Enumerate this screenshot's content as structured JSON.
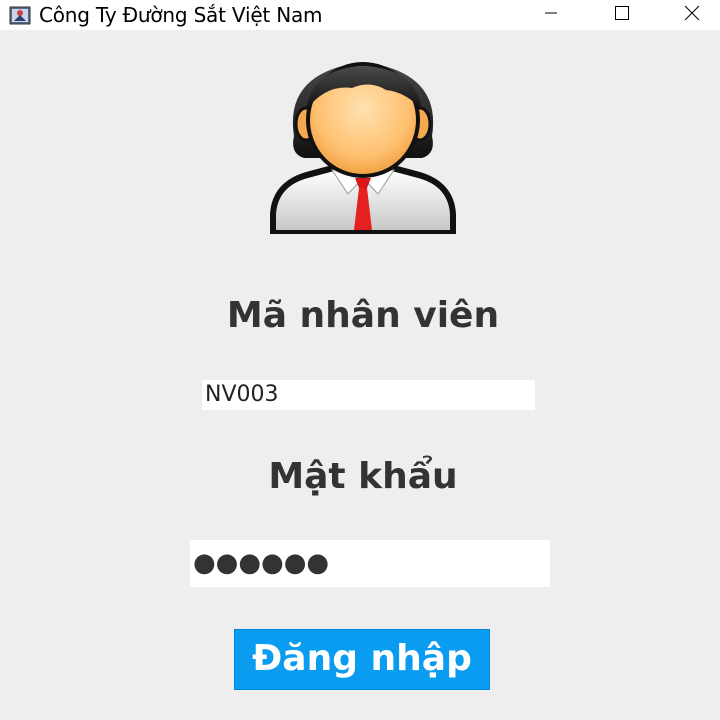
{
  "window": {
    "title": "Công Ty Đường Sắt Việt Nam",
    "app_icon": "java-app-icon",
    "controls": [
      "minimize-icon",
      "maximize-icon",
      "close-icon"
    ]
  },
  "avatar": {
    "icon": "employee-avatar-icon"
  },
  "form": {
    "employee_id_label": "Mã nhân viên",
    "employee_id_value": "NV003",
    "password_label": "Mật khẩu",
    "password_mask": "●●●●●●",
    "login_button_label": "Đăng nhập"
  },
  "colors": {
    "background": "#eeeeee",
    "login_button": "#0a9cf0",
    "label_text": "#333333"
  }
}
